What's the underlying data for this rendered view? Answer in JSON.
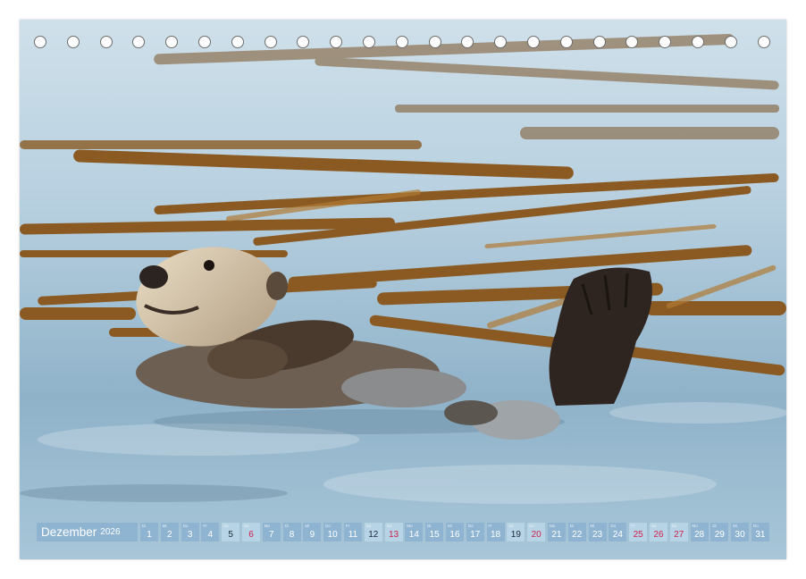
{
  "calendar": {
    "month": "Dezember",
    "year": "2026",
    "days": [
      {
        "num": "1",
        "dow": "Di",
        "type": "weekday"
      },
      {
        "num": "2",
        "dow": "Mi",
        "type": "weekday"
      },
      {
        "num": "3",
        "dow": "Do",
        "type": "weekday"
      },
      {
        "num": "4",
        "dow": "Fr",
        "type": "weekday"
      },
      {
        "num": "5",
        "dow": "Sa",
        "type": "sat"
      },
      {
        "num": "6",
        "dow": "So",
        "type": "sun"
      },
      {
        "num": "7",
        "dow": "Mo",
        "type": "weekday"
      },
      {
        "num": "8",
        "dow": "Di",
        "type": "weekday"
      },
      {
        "num": "9",
        "dow": "Mi",
        "type": "weekday"
      },
      {
        "num": "10",
        "dow": "Do",
        "type": "weekday"
      },
      {
        "num": "11",
        "dow": "Fr",
        "type": "weekday"
      },
      {
        "num": "12",
        "dow": "Sa",
        "type": "sat"
      },
      {
        "num": "13",
        "dow": "So",
        "type": "sun"
      },
      {
        "num": "14",
        "dow": "Mo",
        "type": "weekday"
      },
      {
        "num": "15",
        "dow": "Di",
        "type": "weekday"
      },
      {
        "num": "16",
        "dow": "Mi",
        "type": "weekday"
      },
      {
        "num": "17",
        "dow": "Do",
        "type": "weekday"
      },
      {
        "num": "18",
        "dow": "Fr",
        "type": "weekday"
      },
      {
        "num": "19",
        "dow": "Sa",
        "type": "sat"
      },
      {
        "num": "20",
        "dow": "So",
        "type": "sun"
      },
      {
        "num": "21",
        "dow": "Mo",
        "type": "weekday"
      },
      {
        "num": "22",
        "dow": "Di",
        "type": "weekday"
      },
      {
        "num": "23",
        "dow": "Mi",
        "type": "weekday"
      },
      {
        "num": "24",
        "dow": "Do",
        "type": "weekday"
      },
      {
        "num": "25",
        "dow": "Fr",
        "type": "hol"
      },
      {
        "num": "26",
        "dow": "Sa",
        "type": "hol"
      },
      {
        "num": "27",
        "dow": "So",
        "type": "sun"
      },
      {
        "num": "28",
        "dow": "Mo",
        "type": "weekday"
      },
      {
        "num": "29",
        "dow": "Di",
        "type": "weekday"
      },
      {
        "num": "30",
        "dow": "Mi",
        "type": "weekday"
      },
      {
        "num": "31",
        "dow": "Do",
        "type": "weekday"
      }
    ]
  },
  "colors": {
    "bar": "#8fb4d2",
    "weekend": "#b7d3e6",
    "sunday_text": "#d0214a",
    "water": "#a9c7d9",
    "kelp": "#8a5a22",
    "otter_fur": "#4a3a2e"
  },
  "image": {
    "subject": "sea-otter-photo"
  }
}
